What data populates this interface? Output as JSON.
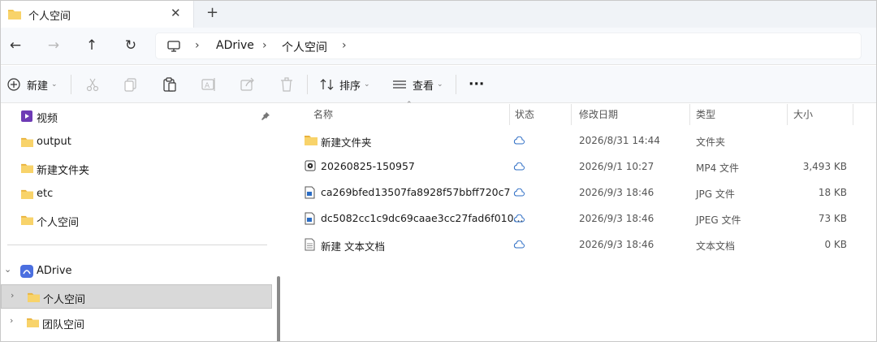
{
  "tab": {
    "title": "个人空间",
    "close_glyph": "✕",
    "new_glyph": "+"
  },
  "nav": {
    "back_glyph": "←",
    "forward_glyph": "→",
    "up_glyph": "↑",
    "refresh_glyph": "↻",
    "breadcrumb": [
      "ADrive",
      "个人空间"
    ],
    "sep_glyph": "›"
  },
  "commands": {
    "new_label": "新建",
    "sort_label": "排序",
    "view_label": "查看",
    "more_glyph": "···",
    "chev_glyph": "⌄"
  },
  "sidebar": {
    "quick": [
      "视频",
      "output",
      "新建文件夹",
      "etc",
      "个人空间"
    ],
    "drive_label": "ADrive",
    "drive_items": [
      "个人空间",
      "团队空间"
    ],
    "chev_glyph": "›",
    "drive_chev_glyph": "⌄"
  },
  "columns": {
    "name": "名称",
    "status": "状态",
    "date": "修改日期",
    "type": "类型",
    "size": "大小",
    "sort_glyph": "⌃"
  },
  "files": [
    {
      "name": "新建文件夹",
      "date": "2026/8/31 14:44",
      "type": "文件夹",
      "size": "",
      "icon": "folder-icon"
    },
    {
      "name": "20260825-150957",
      "date": "2026/9/1 10:27",
      "type": "MP4 文件",
      "size": "3,493 KB",
      "icon": "video-file-icon"
    },
    {
      "name": "ca269bfed13507fa8928f57bbff720c7",
      "date": "2026/9/3 18:46",
      "type": "JPG 文件",
      "size": "18 KB",
      "icon": "image-file-icon"
    },
    {
      "name": "dc5082cc1c9dc69caae3cc27fad6f010...",
      "date": "2026/9/3 18:46",
      "type": "JPEG 文件",
      "size": "73 KB",
      "icon": "image-file-icon"
    },
    {
      "name": "新建 文本文档",
      "date": "2026/9/3 18:46",
      "type": "文本文档",
      "size": "0 KB",
      "icon": "text-file-icon"
    }
  ],
  "colors": {
    "folder": "#f4c54f",
    "accent": "#1e6fd9",
    "selected": "#d9d9d9"
  }
}
